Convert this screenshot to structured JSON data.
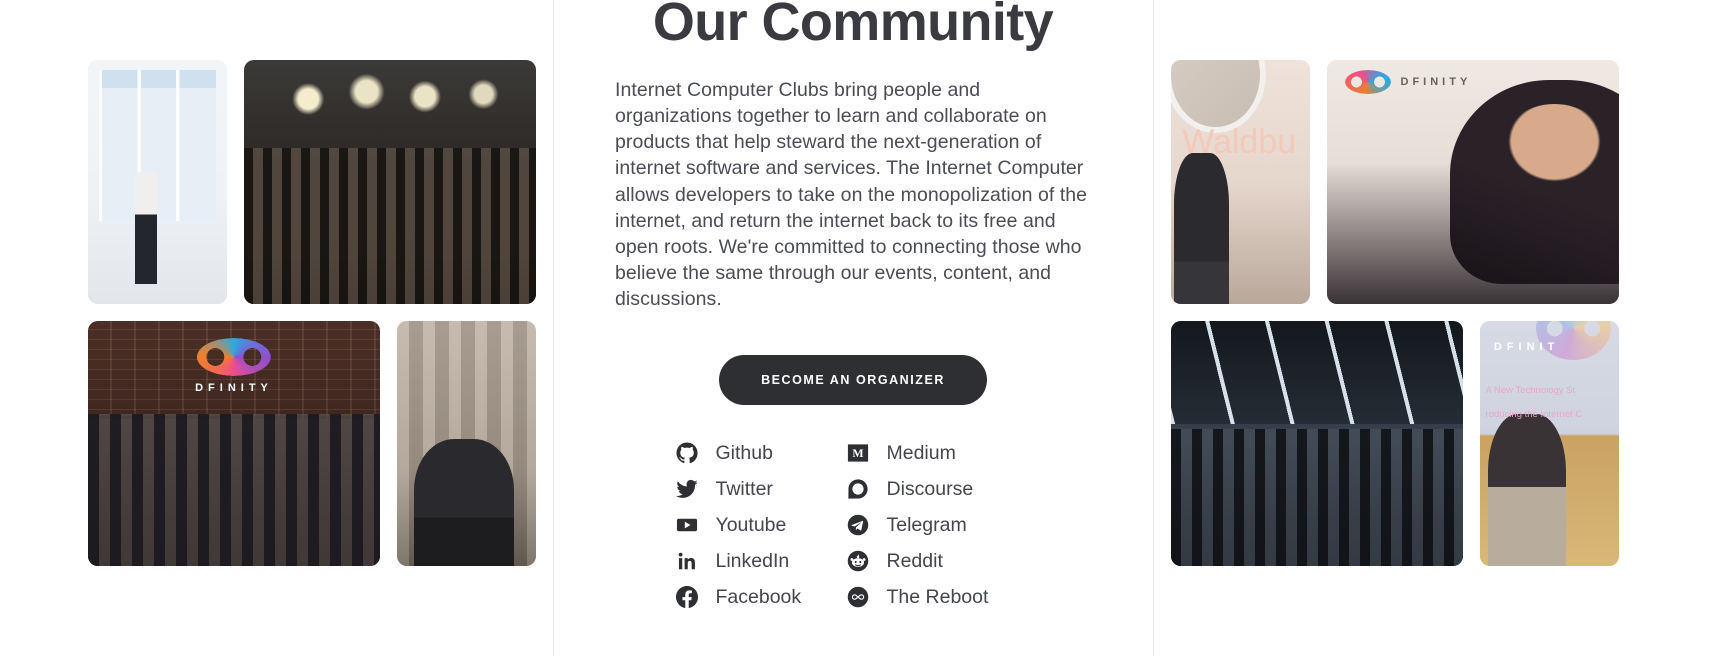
{
  "section": {
    "title": "Our Community",
    "body": "Internet Computer Clubs bring people and organizations together to learn and collaborate on products that help steward the next-generation of internet software and services. The Internet Computer allows developers to take on the monopolization of the internet, and return the internet back to its free and open roots. We're committed to connecting those who believe the same through our events, content, and discussions.",
    "cta_label": "BECOME AN ORGANIZER"
  },
  "colors": {
    "page_background": "#ffffff",
    "heading_text": "#3a3b41",
    "body_text": "#4b4d55",
    "link_text": "#44464e",
    "icon": "#2e2f33",
    "button_background": "#2e2f33",
    "button_text": "#ffffff",
    "divider": "#e8e8e8"
  },
  "social_links": {
    "column_left": [
      {
        "label": "Github",
        "icon": "github-icon"
      },
      {
        "label": "Twitter",
        "icon": "twitter-icon"
      },
      {
        "label": "Youtube",
        "icon": "youtube-icon"
      },
      {
        "label": "LinkedIn",
        "icon": "linkedin-icon"
      },
      {
        "label": "Facebook",
        "icon": "facebook-icon"
      }
    ],
    "column_right": [
      {
        "label": "Medium",
        "icon": "medium-icon"
      },
      {
        "label": "Discourse",
        "icon": "discourse-icon"
      },
      {
        "label": "Telegram",
        "icon": "telegram-icon"
      },
      {
        "label": "Reddit",
        "icon": "reddit-icon"
      },
      {
        "label": "The Reboot",
        "icon": "infinity-icon"
      }
    ]
  },
  "photos": {
    "left": [
      {
        "name": "speaker-by-windows"
      },
      {
        "name": "cheering-crowd-loft"
      },
      {
        "name": "dfinity-team-brick-wall"
      },
      {
        "name": "panel-speaker-curtain"
      }
    ],
    "right": [
      {
        "name": "stage-presenter-waldbu",
        "overlay_text": "Waldbu"
      },
      {
        "name": "panel-speaker-dfinity-backdrop",
        "overlay_text": "DFINITY"
      },
      {
        "name": "large-hall-audience"
      },
      {
        "name": "presenter-dfinity-slide",
        "overlay_text": "DFINIT",
        "overlay_line_1": "A New Technology St",
        "overlay_line_2": "roducing the Internet C"
      }
    ]
  }
}
